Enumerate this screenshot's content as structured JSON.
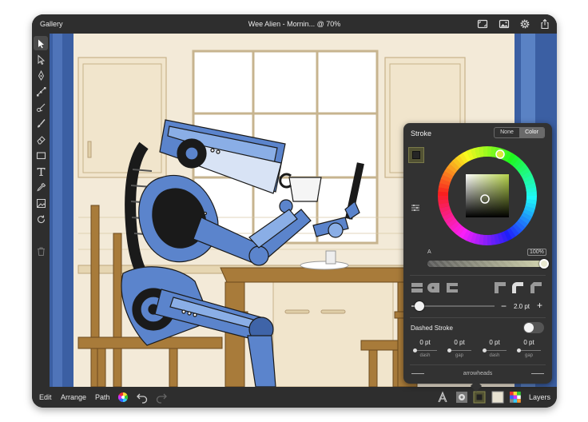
{
  "topbar": {
    "gallery_label": "Gallery",
    "title": "Wee Alien - Mornin... @ 70%",
    "icons": [
      "view-mode-icon",
      "image-icon",
      "gear-icon",
      "share-icon"
    ]
  },
  "toolbar": {
    "tools": [
      "select-arrow-icon",
      "subselect-arrow-icon",
      "pen-icon",
      "node-icon",
      "scissors-icon",
      "brush-icon",
      "eraser-icon",
      "rectangle-icon",
      "text-icon",
      "eyedropper-icon",
      "image-place-icon",
      "rotate-icon",
      "trash-icon"
    ]
  },
  "bottombar": {
    "edit_label": "Edit",
    "arrange_label": "Arrange",
    "path_label": "Path",
    "layers_label": "Layers"
  },
  "stroke_panel": {
    "title": "Stroke",
    "toggle_none": "None",
    "toggle_color": "Color",
    "alpha_label": "A",
    "alpha_value": "100%",
    "width_value": "2.0 pt",
    "minus_label": "−",
    "plus_label": "+",
    "dashed_label": "Dashed Stroke",
    "dashed_on": false,
    "dash_fields": [
      {
        "value": "0 pt",
        "label": "dash"
      },
      {
        "value": "0 pt",
        "label": "gap"
      },
      {
        "value": "0 pt",
        "label": "dash"
      },
      {
        "value": "0 pt",
        "label": "gap"
      }
    ],
    "arrowheads_label": "arrowheads"
  },
  "colors": {
    "chrome": "#2e2e2e",
    "panel": "#323232",
    "robot_blue": "#5b84cc",
    "table_wood": "#a87b3a",
    "wall": "#f3ead8"
  }
}
